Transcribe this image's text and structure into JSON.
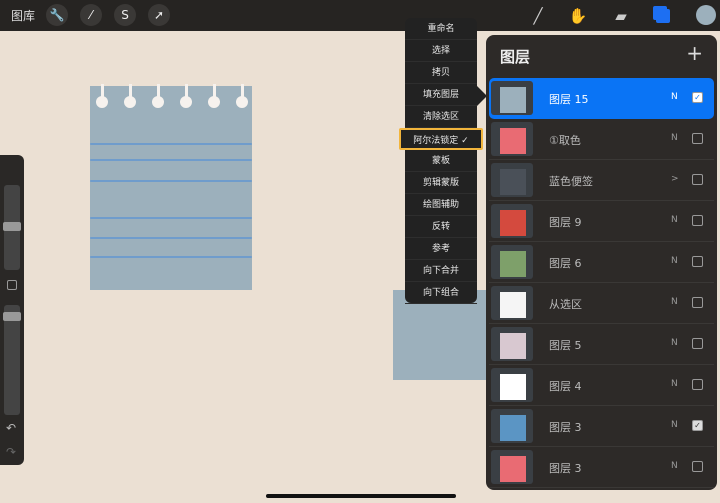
{
  "topbar": {
    "gallery": "图库",
    "left_tools": [
      "wrench-icon",
      "magic-wand-icon",
      "selection-icon",
      "transform-arrow-icon"
    ],
    "right_tools": [
      "brush-icon",
      "smudge-icon",
      "eraser-icon",
      "layers-icon",
      "color-icon"
    ]
  },
  "colors": {
    "accent": "#0a74f5",
    "menu_highlight": "#f2b53c",
    "current_color": "#9cb0bc"
  },
  "menu": {
    "items": [
      {
        "label": "重命名"
      },
      {
        "label": "选择"
      },
      {
        "label": "拷贝"
      },
      {
        "label": "填充图层"
      },
      {
        "label": "清除选区"
      },
      {
        "label": "阿尔法锁定 ✓",
        "selected": true
      },
      {
        "label": "蒙板"
      },
      {
        "label": "剪辑蒙版"
      },
      {
        "label": "绘图辅助"
      },
      {
        "label": "反转"
      },
      {
        "label": "参考"
      },
      {
        "label": "向下合并"
      },
      {
        "label": "向下组合"
      }
    ]
  },
  "layers": {
    "title": "图层",
    "add": "+",
    "items": [
      {
        "name": "图层 15",
        "mode": "N",
        "visible": true,
        "active": true
      },
      {
        "name": "①取色",
        "mode": "N",
        "visible": false
      },
      {
        "name": "蓝色便签",
        "mode": ">",
        "visible": false,
        "group": true
      },
      {
        "name": "图层 9",
        "mode": "N",
        "visible": false
      },
      {
        "name": "图层 6",
        "mode": "N",
        "visible": false
      },
      {
        "name": "从选区",
        "mode": "N",
        "visible": false
      },
      {
        "name": "图层 5",
        "mode": "N",
        "visible": false
      },
      {
        "name": "图层 4",
        "mode": "N",
        "visible": false
      },
      {
        "name": "图层 3",
        "mode": "N",
        "visible": true
      },
      {
        "name": "图层 3",
        "mode": "N",
        "visible": false
      }
    ]
  },
  "sidebar": {
    "undo": "↶",
    "redo": "↷"
  }
}
